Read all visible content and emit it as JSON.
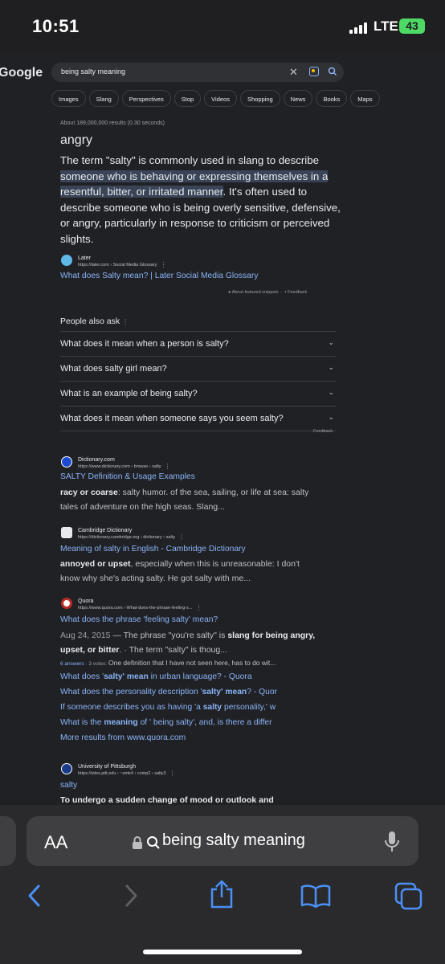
{
  "status": {
    "time": "10:51",
    "network": "LTE",
    "battery": "43"
  },
  "google": {
    "logo": "Google",
    "query": "being salty meaning",
    "chips": [
      "Images",
      "Slang",
      "Perspectives",
      "Stop",
      "Videos",
      "Shopping",
      "News",
      "Books",
      "Maps"
    ],
    "about": "About 189,000,000 results (0.30 seconds)"
  },
  "featured": {
    "title": "angry",
    "text_before": "The term \"salty\" is commonly used in slang to describe ",
    "text_highlight": "someone who is behaving or expressing themselves in a resentful, bitter, or irritated manner",
    "text_after": ". It's often used to describe someone who is being overly sensitive, defensive, or angry, particularly in response to criticism or perceived slights.",
    "site": "Later",
    "url": "https://later.com › Social Media Glossary",
    "link": "What does Salty mean? | Later Social Media Glossary",
    "about_snippets": "About featured snippets",
    "feedback": "Feedback"
  },
  "paa": {
    "title": "People also ask",
    "questions": [
      "What does it mean when a person is salty?",
      "What does salty girl mean?",
      "What is an example of being salty?",
      "What does it mean when someone says you seem salty?"
    ],
    "feedback": "Feedback"
  },
  "results": {
    "dictionary": {
      "site": "Dictionary.com",
      "url": "https://www.dictionary.com › browse › salty",
      "title": "SALTY Definition & Usage Examples",
      "bold": "racy or coarse",
      "snippet": ": salty humor. of the sea, sailing, or life at sea: salty tales of adventure on the high seas. Slang..."
    },
    "cambridge": {
      "site": "Cambridge Dictionary",
      "url": "https://dictionary.cambridge.org › dictionary › salty",
      "title": "Meaning of salty in English - Cambridge Dictionary",
      "bold": "annoyed or upset",
      "snippet": ", especially when this is unreasonable: I don't know why she's acting salty. He got salty with me..."
    },
    "quora": {
      "site": "Quora",
      "url": "https://www.quora.com › What-does-the-phrase-feeling-s...",
      "title": "What does the phrase 'feeling salty' mean?",
      "date": "Aug 24, 2015",
      "s1": " — The phrase \"you're salty\" is ",
      "b1": "slang for being angry, upset, or bitter",
      "s2": ". · The term \"salty\" is thoug...",
      "answers": "6 answers",
      "votes": " · 3 votes: ",
      "answer_snip": "One definition that I have not seen here, has to do wit...",
      "links": [
        {
          "pre": "What does '",
          "bold": "salty' mean",
          "post": " in urban language? - Quora"
        },
        {
          "pre": "What does the personality description '",
          "bold": "salty' mean",
          "post": "? - Quor"
        },
        {
          "pre": "If someone describes you as having 'a ",
          "bold": "salty",
          "post": " personality,' w"
        },
        {
          "pre": "What is the ",
          "bold": "meaning",
          "post": " of ' being salty', and, is there a differ"
        }
      ],
      "more": "More results from www.quora.com"
    },
    "pitt": {
      "site": "University of Pittsburgh",
      "url": "https://sites.pitt.edu › ~emk4 › comp2 › salty3",
      "title": "salty",
      "snippet": "To undergo a sudden change of mood or outlook and"
    }
  },
  "safari": {
    "aa": "AA",
    "url": "being salty meaning"
  }
}
